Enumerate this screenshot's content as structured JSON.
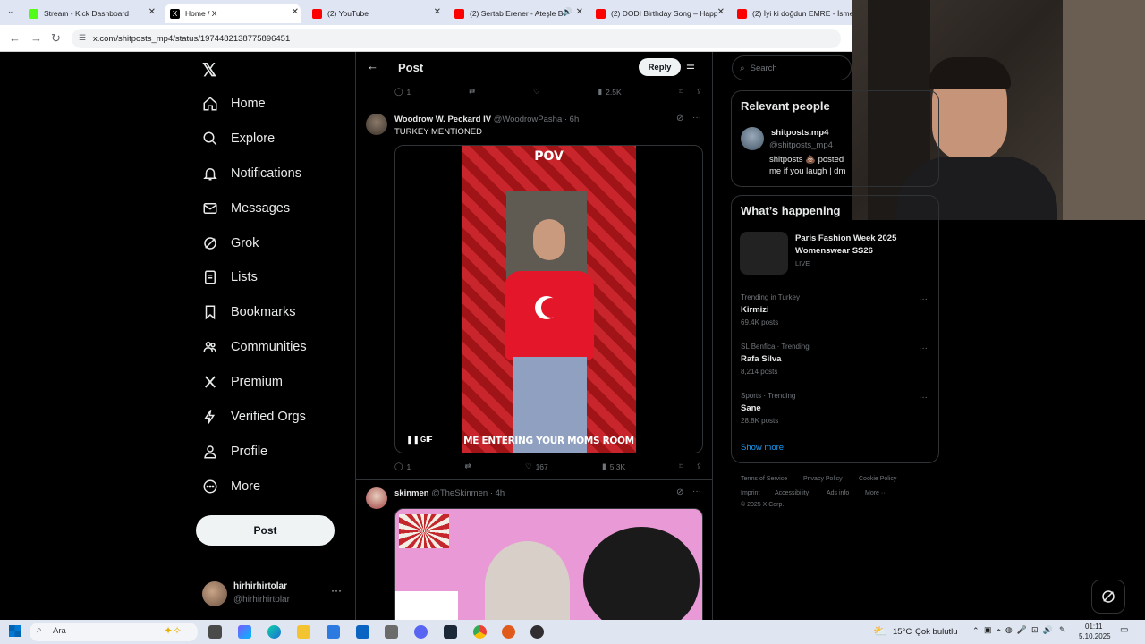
{
  "browser": {
    "tabs": [
      {
        "title": "Stream - Kick Dashboard",
        "color": "#53fc18"
      },
      {
        "title": "Home / X",
        "color": "#000000"
      },
      {
        "title": "(2) YouTube",
        "color": "#ff0000"
      },
      {
        "title": "(2) Sertab Erener - Ateşle B",
        "color": "#ff0000"
      },
      {
        "title": "(2) DODI Birthday Song – Happ",
        "color": "#ff0000"
      },
      {
        "title": "(2) İyi ki doğdun EMRE - İsme C",
        "color": "#ff0000"
      }
    ],
    "url": "x.com/shitposts_mp4/status/1974482138775896451"
  },
  "sidebar": {
    "items": [
      {
        "label": "Home",
        "icon": "home-icon"
      },
      {
        "label": "Explore",
        "icon": "search-icon"
      },
      {
        "label": "Notifications",
        "icon": "bell-icon"
      },
      {
        "label": "Messages",
        "icon": "envelope-icon"
      },
      {
        "label": "Grok",
        "icon": "grok-icon"
      },
      {
        "label": "Lists",
        "icon": "list-icon"
      },
      {
        "label": "Bookmarks",
        "icon": "bookmark-icon"
      },
      {
        "label": "Communities",
        "icon": "people-icon"
      },
      {
        "label": "Premium",
        "icon": "x-icon"
      },
      {
        "label": "Verified Orgs",
        "icon": "lightning-icon"
      },
      {
        "label": "Profile",
        "icon": "person-icon"
      },
      {
        "label": "More",
        "icon": "more-circle-icon"
      }
    ],
    "post_label": "Post",
    "account": {
      "name": "hirhirhirtolar",
      "handle": "@hirhirhirtolar"
    }
  },
  "header": {
    "title": "Post",
    "reply_label": "Reply"
  },
  "tweets": [
    {
      "replies": "1",
      "retweets": "",
      "likes": "",
      "views": "2.5K"
    },
    {
      "name": "Woodrow W. Peckard IV",
      "handle": "@WoodrowPasha",
      "time": "· 6h",
      "text": "TURKEY MENTIONED",
      "media_top": "POV",
      "media_bottom": "ME ENTERING YOUR MOMS ROOM",
      "media_badge": "GIF",
      "replies": "1",
      "retweets": "",
      "likes": "167",
      "views": "5.3K"
    },
    {
      "name": "skinmen",
      "handle": "@TheSkinmen",
      "time": "· 4h"
    }
  ],
  "right": {
    "search_placeholder": "Search",
    "relevant_title": "Relevant people",
    "relevant_person": {
      "name": "shitposts.mp4",
      "handle": "@shitposts_mp4",
      "bio_1": "shitposts 💩 posted",
      "bio_2": "me if you laugh | dm"
    },
    "happening_title": "What’s happening",
    "event": {
      "title_1": "Paris Fashion Week 2025",
      "title_2": "Womenswear SS26",
      "status": "LIVE"
    },
    "trends": [
      {
        "meta": "Trending in Turkey",
        "name": "Kirmizi",
        "count": "69.4K posts"
      },
      {
        "meta": "SL Benfica · Trending",
        "name": "Rafa Silva",
        "count": "8,214 posts"
      },
      {
        "meta": "Sports · Trending",
        "name": "Sane",
        "count": "28.8K posts"
      }
    ],
    "show_more": "Show more",
    "footer": [
      "Terms of Service",
      "Privacy Policy",
      "Cookie Policy",
      "Imprint",
      "Accessibility",
      "Ads info",
      "More ···",
      "© 2025 X Corp."
    ]
  },
  "taskbar": {
    "search_placeholder": "Ara",
    "weather_temp": "15°C",
    "weather_text": "Çok bulutlu",
    "time": "01:11",
    "date": "5.10.2025"
  }
}
